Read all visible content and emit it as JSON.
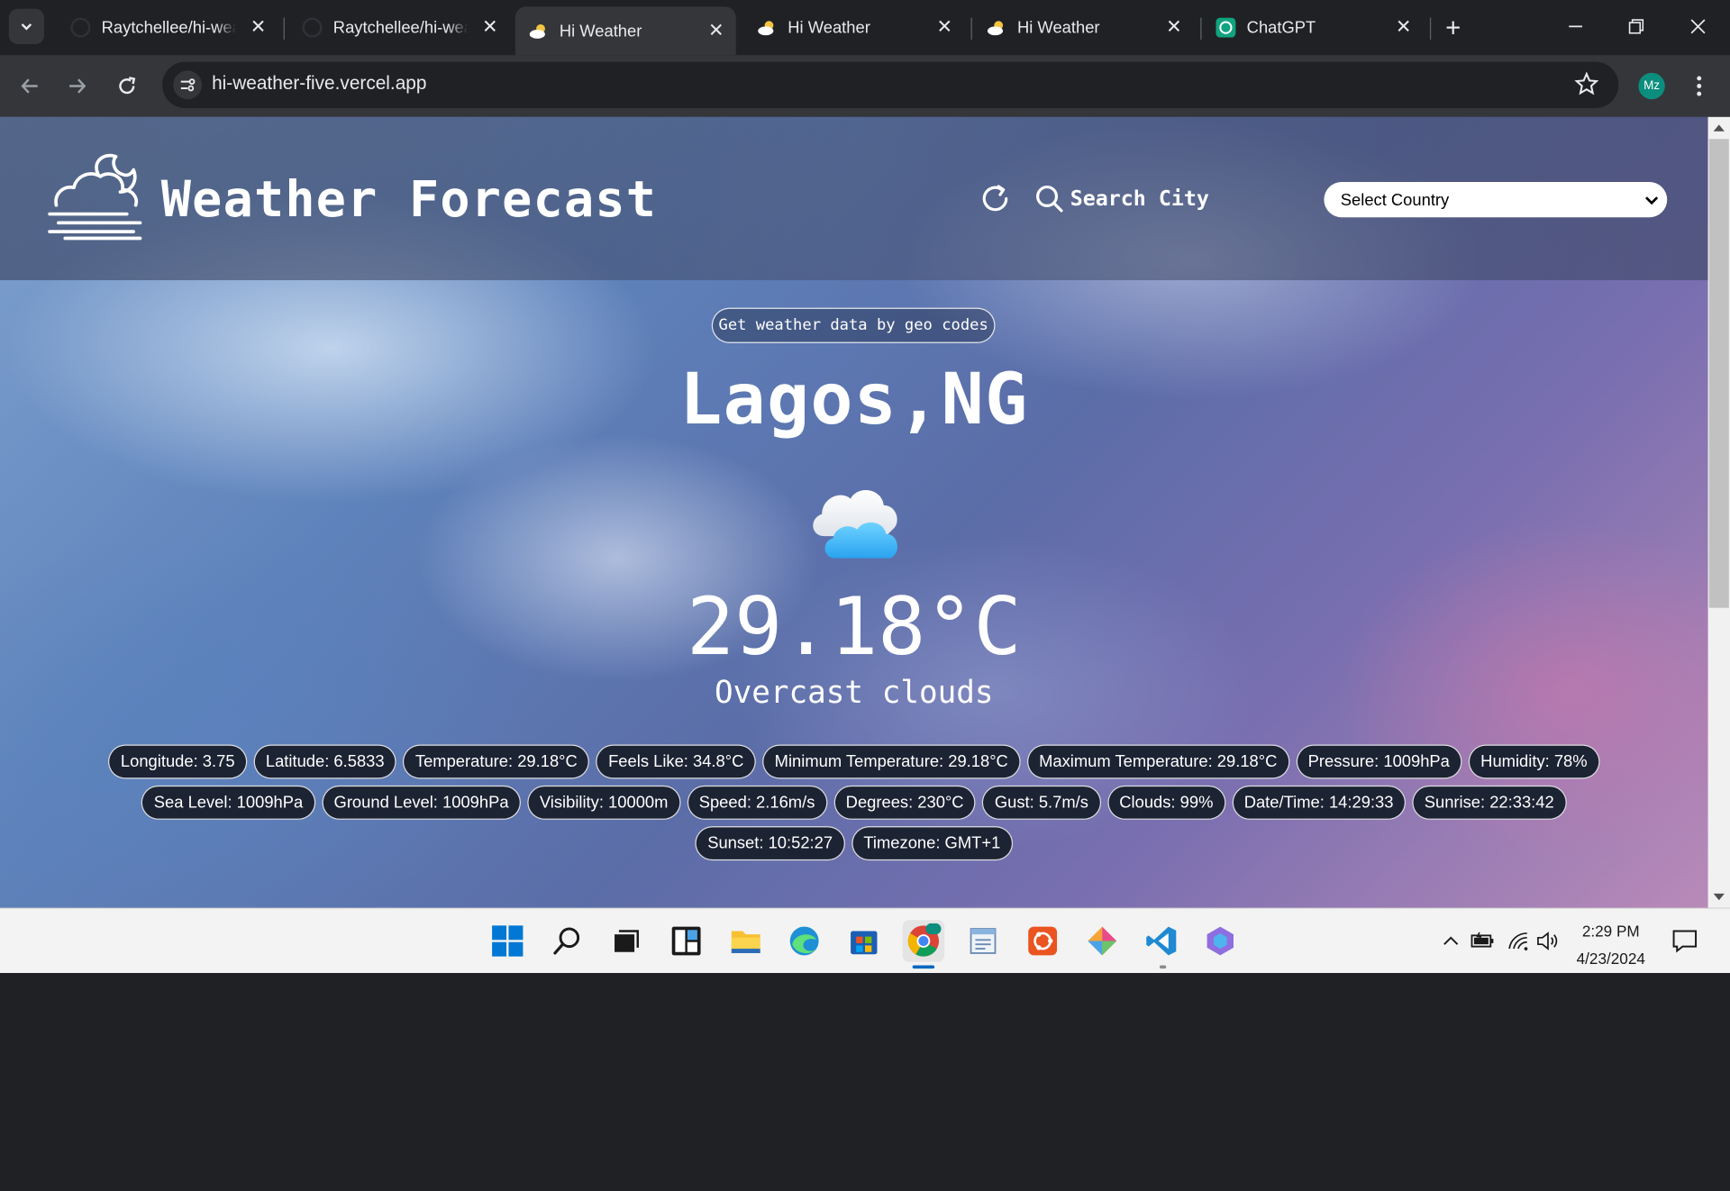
{
  "browser": {
    "tabs": [
      {
        "title": "Raytchellee/hi-weather",
        "icon": "github-icon",
        "active": false
      },
      {
        "title": "Raytchellee/hi-weather",
        "icon": "github-icon",
        "active": false
      },
      {
        "title": "Hi Weather",
        "icon": "weather-favicon",
        "active": true
      },
      {
        "title": "Hi Weather",
        "icon": "weather-favicon",
        "active": false
      },
      {
        "title": "Hi Weather",
        "icon": "weather-favicon",
        "active": false
      },
      {
        "title": "ChatGPT",
        "icon": "chatgpt-icon",
        "active": false
      }
    ],
    "url": "hi-weather-five.vercel.app",
    "profile_initials": "Mz"
  },
  "page": {
    "brand_title": "Weather Forecast",
    "search_label": "Search City",
    "country_select": {
      "selected": "Select Country"
    },
    "geo_button": "Get weather data by geo codes",
    "city": "Lagos,NG",
    "weather_icon": "cloud-icon",
    "temperature": "29.18°C",
    "description": "Overcast clouds",
    "stats": [
      "Longitude: 3.75",
      "Latitude: 6.5833",
      "Temperature: 29.18°C",
      "Feels Like: 34.8°C",
      "Minimum Temperature: 29.18°C",
      "Maximum Temperature: 29.18°C",
      "Pressure: 1009hPa",
      "Humidity: 78%",
      "Sea Level: 1009hPa",
      "Ground Level: 1009hPa",
      "Visibility: 10000m",
      "Speed: 2.16m/s",
      "Degrees: 230°C",
      "Gust: 5.7m/s",
      "Clouds: 99%",
      "Date/Time: 14:29:33",
      "Sunrise: 22:33:42",
      "Sunset: 10:52:27",
      "Timezone: GMT+1"
    ]
  },
  "taskbar": {
    "time": "2:29 PM",
    "date": "4/23/2024",
    "apps": [
      "start",
      "search",
      "task-view",
      "widgets",
      "file-explorer",
      "edge",
      "store",
      "chrome",
      "notepad",
      "ubuntu",
      "app-diamond",
      "vscode",
      "copilot"
    ]
  },
  "colors": {
    "chrome_dark": "#202124",
    "chrome_toolbar": "#35363a",
    "chip_bg": "#1c2333",
    "profile": "#0b8e7d",
    "taskbar": "#f3f3f3"
  }
}
